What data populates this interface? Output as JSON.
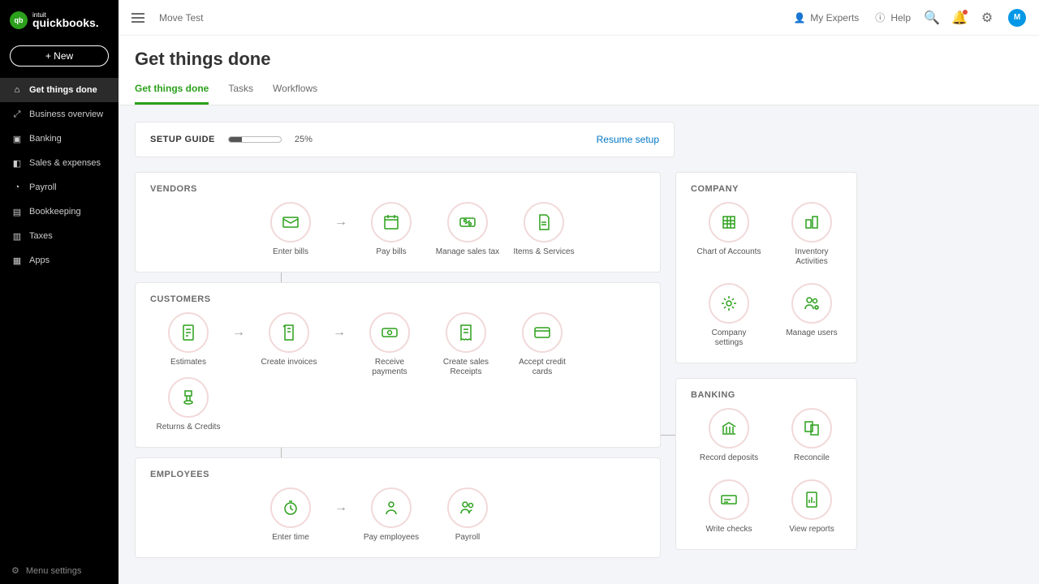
{
  "brand": {
    "intuit": "intuit",
    "name": "quickbooks."
  },
  "new_button": "+  New",
  "sidebar": {
    "items": [
      {
        "label": "Get things done",
        "active": true
      },
      {
        "label": "Business overview"
      },
      {
        "label": "Banking"
      },
      {
        "label": "Sales & expenses"
      },
      {
        "label": "Payroll"
      },
      {
        "label": "Bookkeeping"
      },
      {
        "label": "Taxes"
      },
      {
        "label": "Apps"
      }
    ],
    "footer": "Menu settings"
  },
  "company_name": "Move Test",
  "topbar": {
    "experts": "My Experts",
    "help": "Help",
    "avatar": "M"
  },
  "page": {
    "title": "Get things done"
  },
  "tabs": [
    {
      "label": "Get things done",
      "active": true
    },
    {
      "label": "Tasks"
    },
    {
      "label": "Workflows"
    }
  ],
  "setup": {
    "label": "SETUP GUIDE",
    "percent": 25,
    "pct_text": "25%",
    "resume": "Resume setup"
  },
  "vendors": {
    "title": "VENDORS",
    "items": [
      {
        "label": "Enter bills"
      },
      {
        "label": "Pay bills"
      },
      {
        "label": "Manage sales tax"
      },
      {
        "label": "Items & Services"
      }
    ]
  },
  "customers": {
    "title": "CUSTOMERS",
    "items": [
      {
        "label": "Estimates"
      },
      {
        "label": "Create invoices"
      },
      {
        "label": "Receive payments"
      },
      {
        "label": "Create sales Receipts"
      },
      {
        "label": "Accept credit cards"
      },
      {
        "label": "Returns & Credits"
      }
    ]
  },
  "employees": {
    "title": "EMPLOYEES",
    "items": [
      {
        "label": "Enter time"
      },
      {
        "label": "Pay employees"
      },
      {
        "label": "Payroll"
      }
    ]
  },
  "company_panel": {
    "title": "COMPANY",
    "items": [
      {
        "label": "Chart of Accounts"
      },
      {
        "label": "Inventory Activities"
      },
      {
        "label": "Company settings"
      },
      {
        "label": "Manage users"
      }
    ]
  },
  "banking_panel": {
    "title": "BANKING",
    "items": [
      {
        "label": "Record deposits"
      },
      {
        "label": "Reconcile"
      },
      {
        "label": "Write checks"
      },
      {
        "label": "View reports"
      }
    ]
  }
}
